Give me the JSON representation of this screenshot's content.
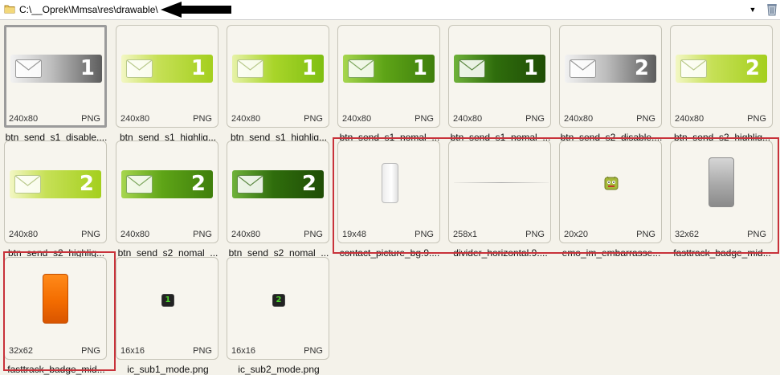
{
  "address_bar": {
    "path": "C:\\__Oprek\\Mmsa\\res\\drawable\\"
  },
  "colors": {
    "accent_red": "#c8323a",
    "tile_bg": "#f7f5ee",
    "window_bg": "#f4f2ea"
  },
  "tiles": [
    {
      "name": "btn_send_s1_disable....",
      "dims": "240x80",
      "format": "PNG",
      "style": "disable",
      "number": "1",
      "selected": true
    },
    {
      "name": "btn_send_s1_highlig...",
      "dims": "240x80",
      "format": "PNG",
      "style": "highlight",
      "number": "1"
    },
    {
      "name": "btn_send_s1_highlig...",
      "dims": "240x80",
      "format": "PNG",
      "style": "highlight2",
      "number": "1"
    },
    {
      "name": "btn_send_s1_nomal_...",
      "dims": "240x80",
      "format": "PNG",
      "style": "nomal",
      "number": "1"
    },
    {
      "name": "btn_send_s1_nomal_...",
      "dims": "240x80",
      "format": "PNG",
      "style": "nomal_dark",
      "number": "1"
    },
    {
      "name": "btn_send_s2_disable....",
      "dims": "240x80",
      "format": "PNG",
      "style": "disable",
      "number": "2"
    },
    {
      "name": "btn_send_s2_highlig...",
      "dims": "240x80",
      "format": "PNG",
      "style": "highlight",
      "number": "2"
    },
    {
      "name": "btn_send_s2_highlig...",
      "dims": "240x80",
      "format": "PNG",
      "style": "highlight",
      "number": "2"
    },
    {
      "name": "btn_send_s2_nomal_...",
      "dims": "240x80",
      "format": "PNG",
      "style": "nomal",
      "number": "2"
    },
    {
      "name": "btn_send_s2_nomal_...",
      "dims": "240x80",
      "format": "PNG",
      "style": "nomal_dark",
      "number": "2"
    },
    {
      "name": "contact_picture_bg.9....",
      "dims": "19x48",
      "format": "PNG",
      "style": "contact"
    },
    {
      "name": "divider_horizontal.9....",
      "dims": "258x1",
      "format": "PNG",
      "style": "divider"
    },
    {
      "name": "emo_im_embarrasse...",
      "dims": "20x20",
      "format": "PNG",
      "style": "emo"
    },
    {
      "name": "fasttrack_badge_mid...",
      "dims": "32x62",
      "format": "PNG",
      "style": "badge_gray"
    },
    {
      "name": "fasttrack_badge_mid...",
      "dims": "32x62",
      "format": "PNG",
      "style": "badge_orange"
    },
    {
      "name": "ic_sub1_mode.png",
      "dims": "16x16",
      "format": "PNG",
      "style": "sub",
      "number": "1"
    },
    {
      "name": "ic_sub2_mode.png",
      "dims": "16x16",
      "format": "PNG",
      "style": "sub",
      "number": "2"
    }
  ]
}
